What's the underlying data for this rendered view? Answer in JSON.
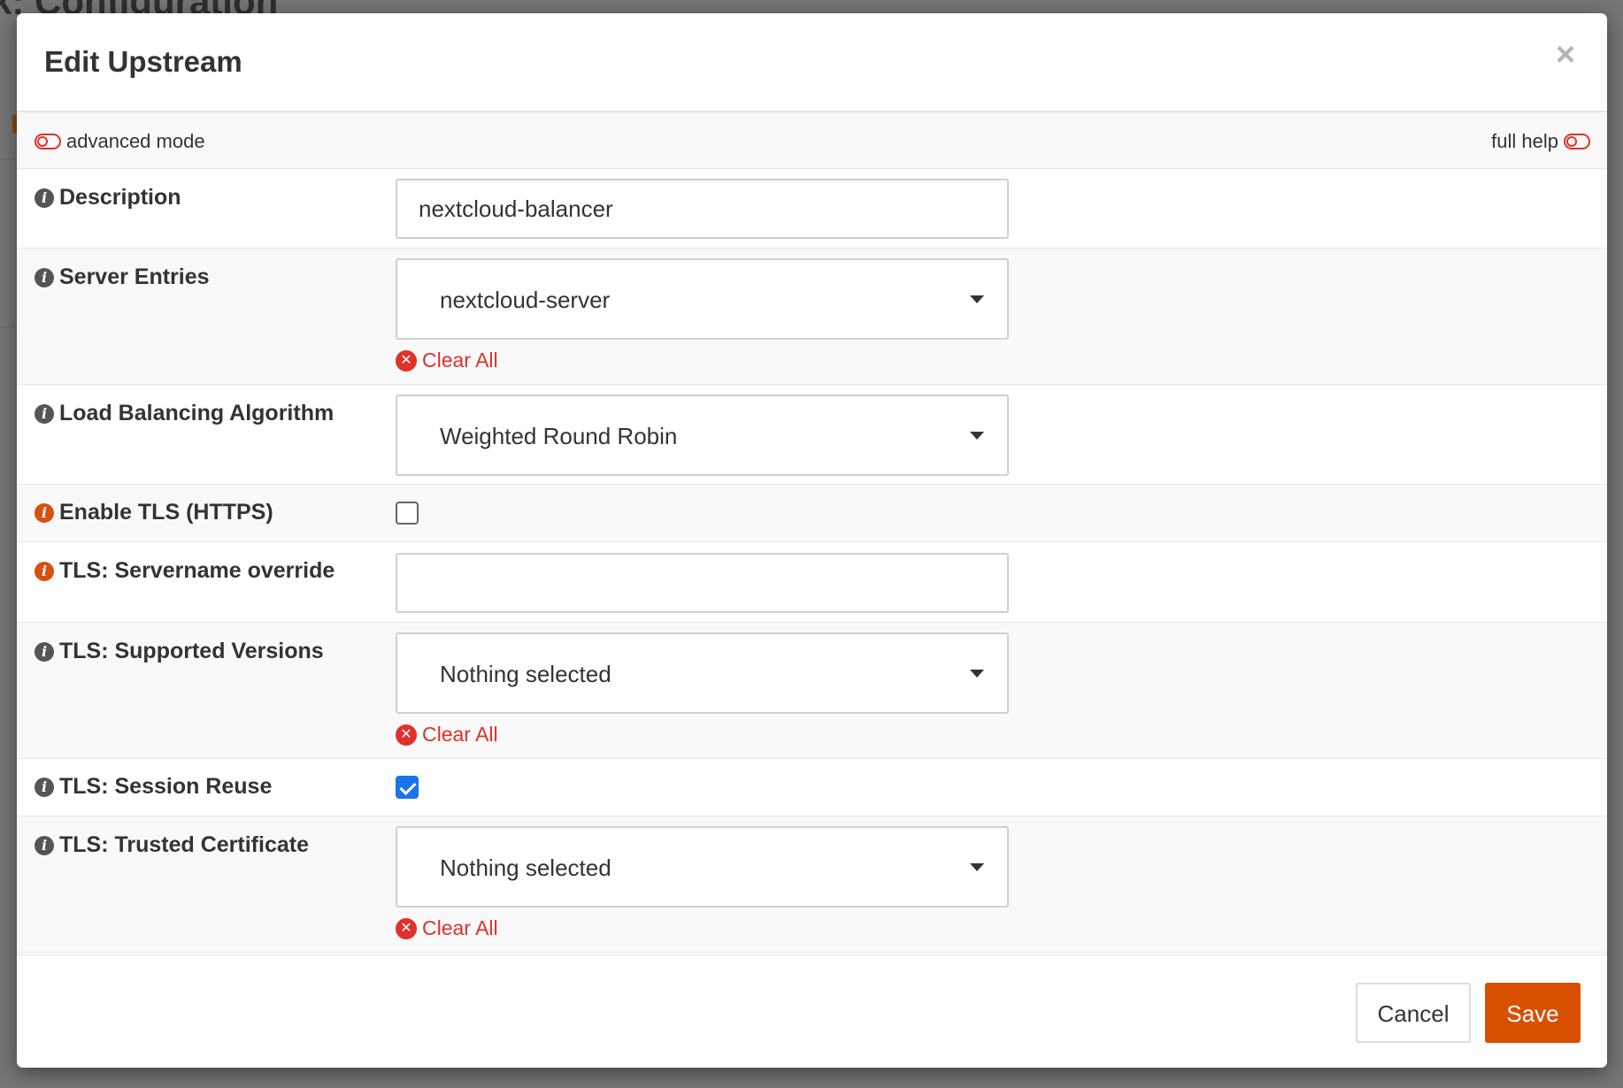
{
  "background": {
    "title_fragment": "k: Configuration"
  },
  "modal": {
    "title": "Edit Upstream",
    "close_glyph": "×"
  },
  "toolbar": {
    "advanced_mode_label": "advanced mode",
    "full_help_label": "full help"
  },
  "fields": {
    "description": {
      "label": "Description",
      "value": "nextcloud-balancer"
    },
    "server_entries": {
      "label": "Server Entries",
      "value": "nextcloud-server",
      "clear_label": "Clear All"
    },
    "load_balancing": {
      "label": "Load Balancing Algorithm",
      "value": "Weighted Round Robin"
    },
    "enable_tls": {
      "label": "Enable TLS (HTTPS)",
      "checked": false
    },
    "tls_servername": {
      "label": "TLS: Servername override",
      "value": ""
    },
    "tls_versions": {
      "label": "TLS: Supported Versions",
      "value": "Nothing selected",
      "clear_label": "Clear All"
    },
    "tls_session_reuse": {
      "label": "TLS: Session Reuse",
      "checked": true
    },
    "tls_trusted_cert": {
      "label": "TLS: Trusted Certificate",
      "value": "Nothing selected",
      "clear_label": "Clear All"
    }
  },
  "footer": {
    "cancel_label": "Cancel",
    "save_label": "Save"
  },
  "colors": {
    "accent": "#d94f00",
    "danger": "#e0312b",
    "checkbox_checked": "#1a73e8"
  },
  "icons": {
    "info": "info-icon",
    "info_orange": "info-icon-orange",
    "clear": "clear-circle-icon",
    "toggle": "toggle-off-icon",
    "caret": "caret-down-icon",
    "close": "close-icon"
  }
}
